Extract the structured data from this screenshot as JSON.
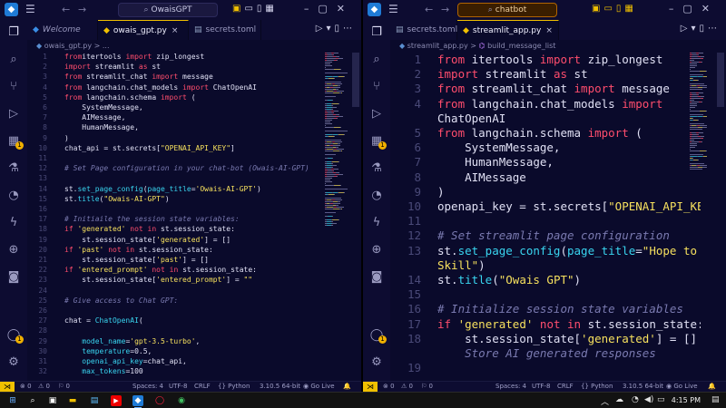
{
  "left": {
    "search": "OwaisGPT",
    "tabs": [
      {
        "label": "Welcome",
        "italic": true,
        "icon": "vscode-icon"
      },
      {
        "label": "owais_gpt.py",
        "active": true,
        "icon": "python-file-icon",
        "close": "×"
      },
      {
        "label": "secrets.toml",
        "icon": "toml-file-icon"
      }
    ],
    "breadcrumb": [
      "owais_gpt.py",
      "..."
    ],
    "lines": [
      {
        "n": "1",
        "code": [
          [
            "k",
            "from"
          ],
          [
            "",
            "itertools "
          ],
          [
            "k",
            "import"
          ],
          [
            "",
            " zip_longest"
          ]
        ]
      },
      {
        "n": "2",
        "code": [
          [
            "k",
            "import"
          ],
          [
            "",
            " streamlit "
          ],
          [
            "k",
            "as"
          ],
          [
            "",
            " st"
          ]
        ]
      },
      {
        "n": "3",
        "code": [
          [
            "k",
            "from"
          ],
          [
            "",
            " streamlit_chat "
          ],
          [
            "k",
            "import"
          ],
          [
            "",
            " message"
          ]
        ]
      },
      {
        "n": "4",
        "code": [
          [
            "k",
            "from"
          ],
          [
            "",
            " langchain.chat_models "
          ],
          [
            "k",
            "import"
          ],
          [
            "",
            " ChatOpenAI"
          ]
        ]
      },
      {
        "n": "5",
        "code": [
          [
            "k",
            "from"
          ],
          [
            "",
            " langchain.schema "
          ],
          [
            "k",
            "import"
          ],
          [
            "",
            " ("
          ]
        ]
      },
      {
        "n": "6",
        "code": [
          [
            "",
            "    SystemMessage,"
          ]
        ]
      },
      {
        "n": "7",
        "code": [
          [
            "",
            "    AIMessage,"
          ]
        ]
      },
      {
        "n": "8",
        "code": [
          [
            "",
            "    HumanMessage,"
          ]
        ]
      },
      {
        "n": "9",
        "code": [
          [
            "",
            ")"
          ]
        ]
      },
      {
        "n": "10",
        "code": [
          [
            "",
            "chat_api = st.secrets["
          ],
          [
            "s",
            "\"OPENAI_API_KEY\""
          ],
          [
            "",
            "]"
          ]
        ]
      },
      {
        "n": "11",
        "code": []
      },
      {
        "n": "12",
        "code": [
          [
            "c",
            "# Set Page configuration in your chat-bot (Owais-AI-GPT)"
          ]
        ]
      },
      {
        "n": "13",
        "code": []
      },
      {
        "n": "14",
        "code": [
          [
            "",
            "st."
          ],
          [
            "fn",
            "set_page_config"
          ],
          [
            "",
            "("
          ],
          [
            "fn",
            "page_title"
          ],
          [
            "",
            "="
          ],
          [
            "s",
            "'Owais-AI-GPT'"
          ],
          [
            "",
            ")"
          ]
        ]
      },
      {
        "n": "15",
        "code": [
          [
            "",
            "st."
          ],
          [
            "fn",
            "title"
          ],
          [
            "",
            "("
          ],
          [
            "s",
            "\"Owais-AI-GPT\""
          ],
          [
            "",
            ")"
          ]
        ]
      },
      {
        "n": "16",
        "code": []
      },
      {
        "n": "17",
        "code": [
          [
            "c",
            "# Initiaile the session state variables:"
          ]
        ]
      },
      {
        "n": "18",
        "code": [
          [
            "k",
            "if"
          ],
          [
            "",
            " "
          ],
          [
            "s",
            "'generated'"
          ],
          [
            "",
            " "
          ],
          [
            "k",
            "not in"
          ],
          [
            "",
            " st.session_state:"
          ]
        ]
      },
      {
        "n": "19",
        "code": [
          [
            "",
            "    st.session_state["
          ],
          [
            "s",
            "'generated'"
          ],
          [
            "",
            "] = []"
          ]
        ]
      },
      {
        "n": "20",
        "code": [
          [
            "k",
            "if"
          ],
          [
            "",
            " "
          ],
          [
            "s",
            "'past'"
          ],
          [
            "",
            " "
          ],
          [
            "k",
            "not in"
          ],
          [
            "",
            " st.session_state:"
          ]
        ]
      },
      {
        "n": "21",
        "code": [
          [
            "",
            "    st.session_state["
          ],
          [
            "s",
            "'past'"
          ],
          [
            "",
            "] = []"
          ]
        ]
      },
      {
        "n": "22",
        "code": [
          [
            "k",
            "if"
          ],
          [
            "",
            " "
          ],
          [
            "s",
            "'entered_prompt'"
          ],
          [
            "",
            " "
          ],
          [
            "k",
            "not in"
          ],
          [
            "",
            " st.session_state:"
          ]
        ]
      },
      {
        "n": "23",
        "code": [
          [
            "",
            "    st.session_state["
          ],
          [
            "s",
            "'entered_prompt'"
          ],
          [
            "",
            "] = "
          ],
          [
            "s",
            "\"\""
          ]
        ]
      },
      {
        "n": "24",
        "code": []
      },
      {
        "n": "25",
        "code": [
          [
            "c",
            "# Give access to Chat GPT:"
          ]
        ]
      },
      {
        "n": "26",
        "code": []
      },
      {
        "n": "27",
        "code": [
          [
            "",
            "chat = "
          ],
          [
            "fn",
            "ChatOpenAI"
          ],
          [
            "",
            "("
          ]
        ]
      },
      {
        "n": "28",
        "code": []
      },
      {
        "n": "29",
        "code": [
          [
            "",
            "    "
          ],
          [
            "fn",
            "model_name"
          ],
          [
            "",
            "="
          ],
          [
            "s",
            "'gpt-3.5-turbo'"
          ],
          [
            "",
            ","
          ]
        ]
      },
      {
        "n": "30",
        "code": [
          [
            "",
            "    "
          ],
          [
            "fn",
            "temperature"
          ],
          [
            "",
            "=0.5,"
          ]
        ]
      },
      {
        "n": "31",
        "code": [
          [
            "",
            "    "
          ],
          [
            "fn",
            "openai_api_key"
          ],
          [
            "",
            "=chat_api,"
          ]
        ]
      },
      {
        "n": "32",
        "code": [
          [
            "",
            "    "
          ],
          [
            "fn",
            "max_tokens"
          ],
          [
            "",
            "=100"
          ]
        ]
      }
    ],
    "status": {
      "errors": "⊗ 0",
      "warnings": "⚠ 0",
      "info": "⚐ 0",
      "spaces": "Spaces: 4",
      "encoding": "UTF-8",
      "eol": "CRLF",
      "language": "{} Python",
      "interpreter": "3.10.5 64-bit",
      "golive": "◉ Go Live"
    }
  },
  "right": {
    "search": "chatbot",
    "tabs": [
      {
        "label": "secrets.toml",
        "icon": "toml-file-icon"
      },
      {
        "label": "streamlit_app.py",
        "active": true,
        "icon": "python-file-icon",
        "close": "×"
      }
    ],
    "breadcrumb": [
      "streamlit_app.py",
      "build_message_list"
    ],
    "lines": [
      {
        "n": "1",
        "code": [
          [
            "k",
            "from"
          ],
          [
            "",
            " itertools "
          ],
          [
            "k",
            "import"
          ],
          [
            "",
            " zip_longest"
          ]
        ]
      },
      {
        "n": "2",
        "code": [
          [
            "k",
            "import"
          ],
          [
            "",
            " streamlit "
          ],
          [
            "k",
            "as"
          ],
          [
            "",
            " st"
          ]
        ]
      },
      {
        "n": "3",
        "code": [
          [
            "k",
            "from"
          ],
          [
            "",
            " streamlit_chat "
          ],
          [
            "k",
            "import"
          ],
          [
            "",
            " message"
          ]
        ]
      },
      {
        "n": "4",
        "code": [
          [
            "k",
            "from"
          ],
          [
            "",
            " langchain.chat_models "
          ],
          [
            "k",
            "import"
          ]
        ]
      },
      {
        "n": "",
        "code": [
          [
            "",
            "ChatOpenAI"
          ]
        ]
      },
      {
        "n": "5",
        "code": [
          [
            "k",
            "from"
          ],
          [
            "",
            " langchain.schema "
          ],
          [
            "k",
            "import"
          ],
          [
            "",
            " ("
          ]
        ]
      },
      {
        "n": "6",
        "code": [
          [
            "",
            "    SystemMessage,"
          ]
        ]
      },
      {
        "n": "7",
        "code": [
          [
            "",
            "    HumanMessage,"
          ]
        ]
      },
      {
        "n": "8",
        "code": [
          [
            "",
            "    AIMessage"
          ]
        ]
      },
      {
        "n": "9",
        "code": [
          [
            "",
            ")"
          ]
        ]
      },
      {
        "n": "10",
        "code": [
          [
            "",
            "openapi_key = st.secrets["
          ],
          [
            "s",
            "\"OPENAI_API_KEY\""
          ],
          [
            "",
            "]"
          ]
        ]
      },
      {
        "n": "11",
        "code": []
      },
      {
        "n": "12",
        "code": [
          [
            "c",
            "# Set streamlit page configuration"
          ]
        ]
      },
      {
        "n": "13",
        "code": [
          [
            "",
            "st."
          ],
          [
            "fn",
            "set_page_config"
          ],
          [
            "",
            "("
          ],
          [
            "fn",
            "page_title"
          ],
          [
            "",
            "="
          ],
          [
            "s",
            "\"Hope to"
          ]
        ]
      },
      {
        "n": "",
        "code": [
          [
            "s",
            "Skill\""
          ],
          [
            "",
            ")"
          ]
        ]
      },
      {
        "n": "14",
        "code": [
          [
            "",
            "st."
          ],
          [
            "fn",
            "title"
          ],
          [
            "",
            "("
          ],
          [
            "s",
            "\"Owais GPT\""
          ],
          [
            "",
            ")"
          ]
        ]
      },
      {
        "n": "15",
        "code": []
      },
      {
        "n": "16",
        "code": [
          [
            "c",
            "# Initialize session state variables"
          ]
        ]
      },
      {
        "n": "17",
        "code": [
          [
            "k",
            "if"
          ],
          [
            "",
            " "
          ],
          [
            "s",
            "'generated'"
          ],
          [
            "",
            " "
          ],
          [
            "k",
            "not in"
          ],
          [
            "",
            " st.session_state:"
          ]
        ]
      },
      {
        "n": "18",
        "code": [
          [
            "",
            "    st.session_state["
          ],
          [
            "s",
            "'generated'"
          ],
          [
            "",
            "] = []  "
          ],
          [
            "c",
            "#"
          ]
        ]
      },
      {
        "n": "",
        "code": [
          [
            "c",
            "    Store AI generated responses"
          ]
        ]
      },
      {
        "n": "19",
        "code": []
      }
    ],
    "status": {
      "errors": "⊗ 0",
      "warnings": "⚠ 0",
      "info": "⚐ 0",
      "spaces": "Spaces: 4",
      "encoding": "UTF-8",
      "eol": "CRLF",
      "language": "{} Python",
      "interpreter": "3.10.5 64-bit",
      "golive": "◉ Go Live"
    }
  },
  "badge_count": "1",
  "clock": "4:15 PM",
  "colors": {
    "accent": "#f0c000",
    "keyword": "#ff4d6d",
    "string": "#f6e05e",
    "function": "#39d5f0",
    "comment": "#7a7ab0"
  }
}
